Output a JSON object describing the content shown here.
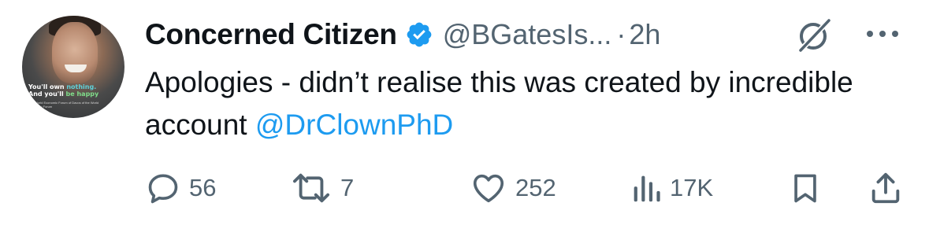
{
  "tweet": {
    "author_name": "Concerned Citizen",
    "author_handle": "@BGatesIs...",
    "separator": "·",
    "timestamp": "2h",
    "text_prefix": "Apologies - didn’t realise this was created by incredible account ",
    "mention": "@DrClownPhD",
    "verified_icon": "verified-badge-icon",
    "avatar": {
      "caption_line1_a": "You'll own ",
      "caption_line1_b": "nothing.",
      "caption_line2_a": "And you'll ",
      "caption_line2_b": "be happy",
      "caption_small": "The World Economic Forum of Davos of the World Economic Forum"
    }
  },
  "actions": {
    "reply_count": "56",
    "repost_count": "7",
    "like_count": "252",
    "views_count": "17K"
  },
  "icons": {
    "reply": "comment-bubble-icon",
    "repost": "repost-arrows-icon",
    "like": "heart-icon",
    "views": "bar-chart-icon",
    "bookmark": "bookmark-icon",
    "share": "share-upload-icon",
    "grok": "grok-slash-icon",
    "more": "more-dots-icon"
  },
  "colors": {
    "text": "#0f1419",
    "secondary": "#536471",
    "link": "#1d9bf0",
    "verified": "#1d9bf0"
  }
}
